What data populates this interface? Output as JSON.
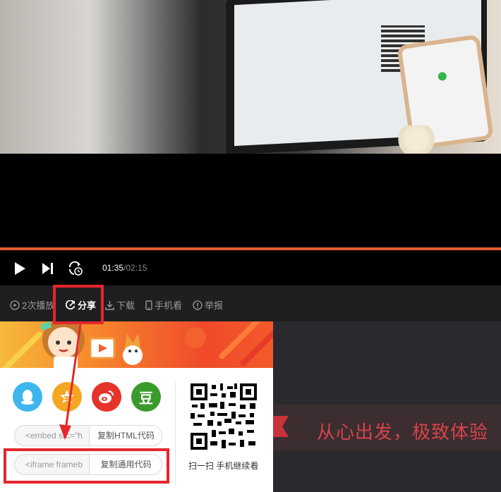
{
  "player": {
    "current_time": "01:35",
    "total_time": "/02:15",
    "progress": 1.0
  },
  "actions": {
    "plays": "2次播放",
    "share": "分享",
    "download": "下载",
    "mobile": "手机看",
    "report": "举报"
  },
  "share_panel": {
    "social": {
      "qq": "QQ",
      "qzone": "QQ空间",
      "weibo": "微博",
      "douban": "豆"
    },
    "embed_html": {
      "value": "<embed src=\"h",
      "button": "复制HTML代码"
    },
    "iframe": {
      "value": "<iframe frameb",
      "button": "复制通用代码"
    },
    "qr_caption": "扫一扫 手机继续看"
  },
  "promo": {
    "text": "从心出发，极致体验"
  },
  "colors": {
    "accent": "#e85c32",
    "highlight": "#e5262c",
    "qq": "#3cb6ec",
    "qzone": "#f5a623",
    "weibo": "#e6332a",
    "douban": "#3a9a2b"
  }
}
